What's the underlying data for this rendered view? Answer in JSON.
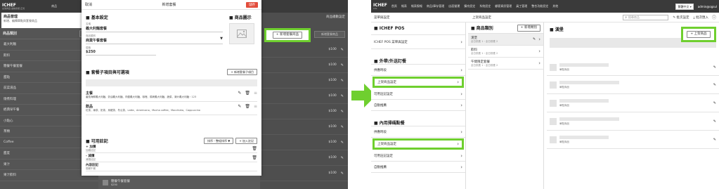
{
  "left": {
    "topbar_title": "ICHEF",
    "topbar_sub": "台灣商店-連線系統-正式",
    "topbar_tab": "商品",
    "menu_title": "商品管理",
    "menu_sub": "新增、編輯單點與套餐商品",
    "category_header": "商品類別",
    "add_category": "新增類別",
    "categories": [
      "義大利麵",
      "飲料",
      "簡餐午餐套餐",
      "甜點",
      "前菜湯品",
      "燉煮料理",
      "經典早午餐",
      "小點心",
      "茶類",
      "Coffee",
      "甜度",
      "果汁",
      "果汁飲料"
    ],
    "prices": [
      "$100",
      "$100",
      "$100",
      "$100",
      "$100",
      "$100",
      "$100",
      "$100",
      "$100"
    ],
    "right_header": "商品總數設定",
    "add_set_button": "新增套餐商品",
    "bottom_item": "簡餐午餐套餐",
    "bottom_item_sub": "$250"
  },
  "modal": {
    "cancel": "取消",
    "title": "新增套餐",
    "save": "儲存",
    "basic_section": "基本設定",
    "image_section": "商品圖示",
    "name_label": "名稱",
    "name_value": "義大利麵套餐",
    "category_label": "商品類別",
    "category_value": "商業午餐套餐",
    "price_label": "價格",
    "price_value": "$250",
    "set_section": "套餐子項目與可選項",
    "add_set_item": "新增套餐子項目",
    "main_label": "主餐",
    "main_desc": "番茄海鮮義大利麵、奶油義大利麵、肉醬義大利麵、咖哩、焗烤義大利麵、蔬菜、清炒義大利麵・123",
    "drink_label": "飲品",
    "drink_desc": "紅茶、綠茶、奶茶、烏龍茶、冬瓜茶、Latte、Americano、Mocha coffee、Macchiato、Cappuccino",
    "addon_section": "可用註記",
    "sort_button": "排序・整組排序",
    "add_note": "加入註記",
    "notes": [
      {
        "label": "+ 加價",
        "sub": "加價註記"
      },
      {
        "label": "- 減價",
        "sub": "減價註記"
      },
      {
        "label": "內容註記",
        "sub": "簡餐午餐"
      }
    ]
  },
  "right": {
    "brand": "ICHEF",
    "brand_sub": "Lite",
    "nav": [
      "首頁",
      "報表",
      "報表撥報",
      "商品/庫存管理",
      "店面營運",
      "擴充設定",
      "系統設定",
      "顧客資訊管理",
      "員工管理",
      "整合功能設定",
      "其他"
    ],
    "lang": "繁體中文",
    "user": "admin@ogsul",
    "subbar_left": "菜單與設定",
    "subbar_mid": "上架商品設定",
    "search_placeholder": "搜尋商品",
    "batch_edit": "批次設定",
    "batch_import": "批次匯入",
    "settings_col": [
      {
        "header": "ICHEF POS",
        "items": [
          "ICHEF POS 菜單與設定"
        ]
      },
      {
        "header": "外帶/外送訂餐",
        "items": [
          "供應時段",
          "上架商品設定",
          "可用註記設定",
          "自動推薦"
        ]
      },
      {
        "header": "內用掃碼點餐",
        "items": [
          "供應時段",
          "上架商品設定",
          "可用註記設定",
          "自動推薦"
        ]
      }
    ],
    "cat_header": "商品類別",
    "add_cat": "新增類別",
    "cats": [
      {
        "name": "漢堡",
        "sub": "全日供應 1・全日供應 2"
      },
      {
        "name": "飲料",
        "sub": "全日供應 1・全日供應 2"
      },
      {
        "name": "午間限定套餐",
        "sub": "全日供應 1・全日供應 2"
      }
    ],
    "items_header": "漢堡",
    "add_item": "上架商品",
    "item_tag": "單點商品"
  }
}
